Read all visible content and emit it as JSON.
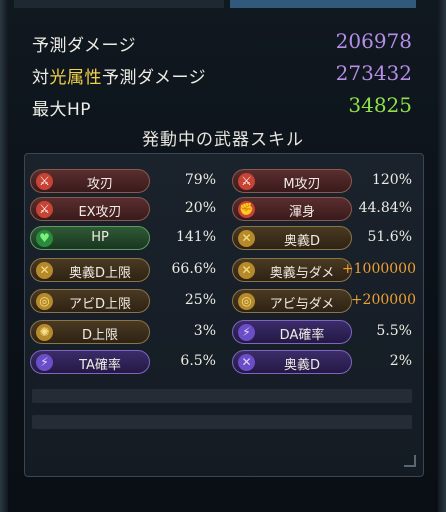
{
  "stats": {
    "expected_damage_label": "予測ダメージ",
    "expected_damage_value": "206978",
    "element_prefix": "対",
    "element_name": "光属性",
    "element_damage_suffix": "予測ダメージ",
    "element_damage_value": "273432",
    "max_hp_label": "最大HP",
    "max_hp_value": "34825"
  },
  "skills_title": "発動中の武器スキル",
  "skills": [
    {
      "left": {
        "label": "攻刃",
        "value": "79%",
        "icon": "sword-icon"
      },
      "right": {
        "label": "M攻刃",
        "value": "120%",
        "icon": "sword-icon"
      }
    },
    {
      "left": {
        "label": "EX攻刃",
        "value": "20%",
        "icon": "sword-icon"
      },
      "right": {
        "label": "渾身",
        "value": "44.84%",
        "icon": "flexed-arm-icon"
      }
    },
    {
      "left": {
        "label": "HP",
        "value": "141%",
        "icon": "heart-icon"
      },
      "right": {
        "label": "奥義D",
        "value": "51.6%",
        "icon": "crossed-swords-icon"
      }
    },
    {
      "left": {
        "label": "奥義D上限",
        "value": "66.6%",
        "icon": "crossed-swords-icon"
      },
      "right": {
        "label": "奥義与ダメ",
        "value": "+1000000",
        "icon": "crossed-swords-icon"
      }
    },
    {
      "left": {
        "label": "アビD上限",
        "value": "25%",
        "icon": "ability-icon"
      },
      "right": {
        "label": "アビ与ダメ",
        "value": "+200000",
        "icon": "ability-icon"
      }
    },
    {
      "left": {
        "label": "D上限",
        "value": "3%",
        "icon": "gear-icon"
      },
      "right": {
        "label": "DA確率",
        "value": "5.5%",
        "icon": "double-slash-icon"
      }
    },
    {
      "left": {
        "label": "TA確率",
        "value": "6.5%",
        "icon": "triple-slash-icon"
      },
      "right": {
        "label": "奥義D",
        "value": "2%",
        "icon": "crossed-swords-icon"
      }
    }
  ],
  "colors": {
    "damage_value": "#b68ee8",
    "hp_value": "#8fe04a",
    "element_highlight": "#f2d24a",
    "bonus_value": "#f0a030"
  }
}
